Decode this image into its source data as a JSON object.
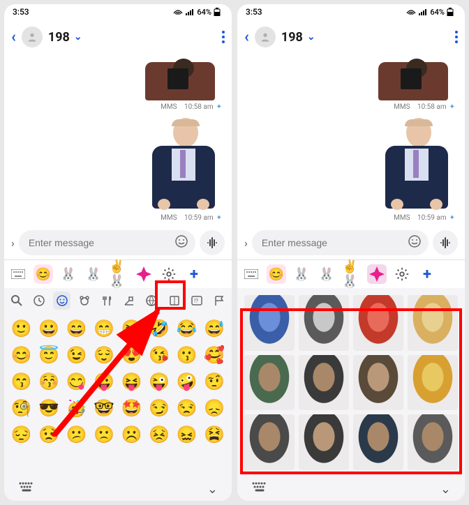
{
  "statusbar": {
    "time": "3:53",
    "battery": "64%"
  },
  "header": {
    "contact_name": "198"
  },
  "messages": [
    {
      "type": "MMS",
      "time": "10:58 am"
    },
    {
      "type": "MMS",
      "time": "10:59 am"
    }
  ],
  "input": {
    "placeholder": "Enter message"
  },
  "keyboard_tabs": {
    "items": [
      "keyboard-icon",
      "avatar-emoji",
      "bunny-1",
      "bunny-yellow",
      "bunny-gesture",
      "sticker-star",
      "settings",
      "add"
    ]
  },
  "emoji_categories": [
    "search",
    "recent",
    "smileys",
    "animals",
    "food",
    "activity",
    "sports",
    "objects",
    "symbols",
    "flags"
  ],
  "emojis": [
    "🙂",
    "😀",
    "😄",
    "😁",
    "😆",
    "🤣",
    "😂",
    "😅",
    "😊",
    "😇",
    "😉",
    "😌",
    "😍",
    "😘",
    "😗",
    "🥰",
    "😙",
    "😚",
    "😋",
    "😛",
    "😝",
    "😜",
    "🤪",
    "🤨",
    "🧐",
    "😎",
    "🥳",
    "🤓",
    "🤩",
    "😏",
    "😒",
    "😞",
    "😔",
    "😟",
    "😕",
    "🙁",
    "☹️",
    "😣",
    "😖",
    "😫"
  ],
  "sticker_thumbs": [
    "blue-container",
    "lamp",
    "red-tree",
    "hand-plate",
    "person-gesture-1",
    "person-talking",
    "person-portrait",
    "jar",
    "person-sitting-1",
    "person-headshot",
    "person-cap",
    "person-bike"
  ]
}
